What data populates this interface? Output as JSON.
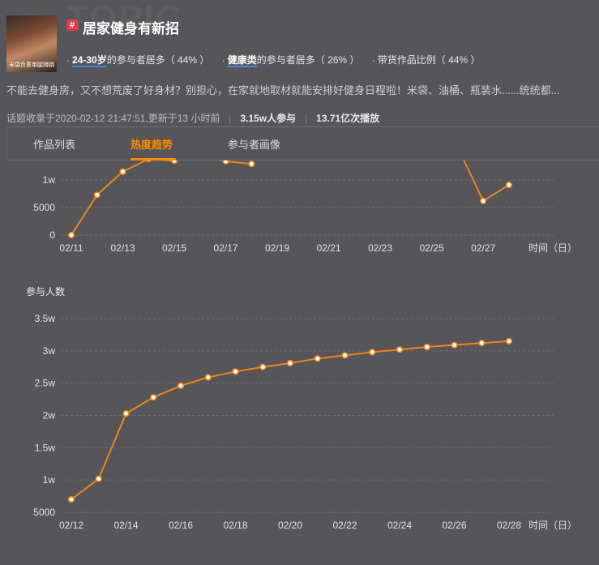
{
  "topic": {
    "watermark": "TOPIC",
    "hash_icon": "#",
    "title": "居家健身有新招",
    "thumbnail_caption": "米袋负重单腿蹲跳"
  },
  "tags": [
    {
      "highlight": "24-30岁",
      "text": "的参与者居多（ 44% ）"
    },
    {
      "highlight": "健康类",
      "text": "的参与者居多（ 26% ）"
    },
    {
      "highlight": "",
      "text": "带货作品比例（ 44% ）"
    }
  ],
  "description": "不能去健身房，又不想荒废了好身材？别担心，在家就地取材就能安排好健身日程啦！米袋、油桶、瓶装水......统统都...",
  "meta": {
    "recorded": "话题收录于2020-02-12 21:47:51,更新于13 小时前",
    "participants": "3.15w人参与",
    "plays": "13.71亿次播放"
  },
  "tabs": [
    {
      "label": "作品列表",
      "active": false
    },
    {
      "label": "热度趋势",
      "active": true
    },
    {
      "label": "参与者画像",
      "active": false
    }
  ],
  "colors": {
    "accent": "#ff8a00",
    "line": "#f08519",
    "tag_underline": "#3f86d8",
    "background": "#56555a"
  },
  "chart_data": [
    {
      "type": "line",
      "title": "",
      "xlabel": "时间（日）",
      "ylabel": "",
      "yticks": [
        {
          "v": 0,
          "label": "0"
        },
        {
          "v": 5000,
          "label": "5000"
        },
        {
          "v": 10000,
          "label": "1w"
        }
      ],
      "xtick_labels": [
        "02/11",
        "02/13",
        "02/15",
        "02/17",
        "02/19",
        "02/21",
        "02/23",
        "02/25",
        "02/27"
      ],
      "x": [
        "02/11",
        "02/12",
        "02/13",
        "02/14",
        "02/15",
        "02/16",
        "02/17",
        "02/18",
        "02/19",
        "02/20",
        "02/21",
        "02/22",
        "02/23",
        "02/24",
        "02/25",
        "02/26",
        "02/27",
        "02/28"
      ],
      "values": [
        0,
        7300,
        11500,
        13800,
        13500,
        14500,
        13400,
        12900,
        null,
        null,
        null,
        null,
        null,
        null,
        null,
        16000,
        6200,
        9100
      ],
      "note_visible_range": [
        -300,
        14500
      ]
    },
    {
      "type": "line",
      "title": "参与人数",
      "xlabel": "时间（日）",
      "ylabel": "",
      "yticks": [
        {
          "v": 5000,
          "label": "5000"
        },
        {
          "v": 10000,
          "label": "1w"
        },
        {
          "v": 15000,
          "label": "1.5w"
        },
        {
          "v": 20000,
          "label": "2w"
        },
        {
          "v": 25000,
          "label": "2.5w"
        },
        {
          "v": 30000,
          "label": "3w"
        },
        {
          "v": 35000,
          "label": "3.5w"
        }
      ],
      "xtick_labels": [
        "02/12",
        "02/14",
        "02/16",
        "02/18",
        "02/20",
        "02/22",
        "02/24",
        "02/26",
        "02/28"
      ],
      "x": [
        "02/12",
        "02/13",
        "02/14",
        "02/15",
        "02/16",
        "02/17",
        "02/18",
        "02/19",
        "02/20",
        "02/21",
        "02/22",
        "02/23",
        "02/24",
        "02/25",
        "02/26",
        "02/27",
        "02/28"
      ],
      "values": [
        7000,
        10200,
        20300,
        22800,
        24600,
        25900,
        26800,
        27500,
        28100,
        28800,
        29300,
        29800,
        30200,
        30600,
        30900,
        31200,
        31500
      ],
      "ylim": [
        5000,
        35000
      ]
    }
  ]
}
